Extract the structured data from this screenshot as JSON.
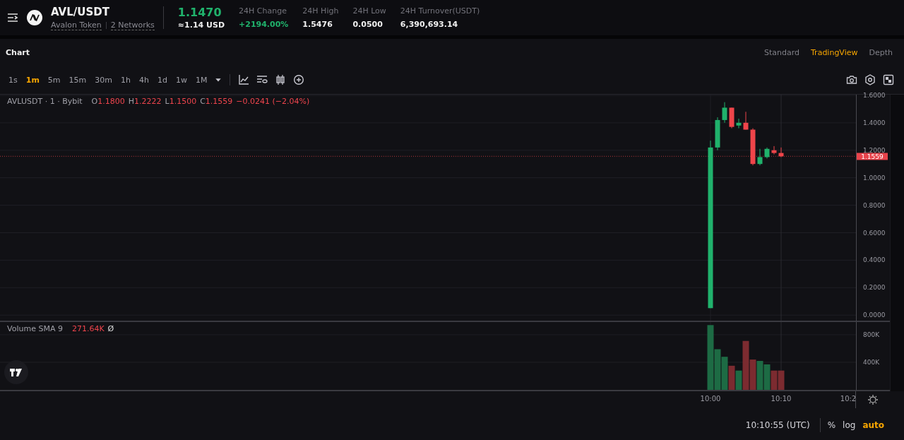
{
  "header": {
    "pair": "AVL/USDT",
    "token_name": "Avalon Token",
    "networks": "2 Networks",
    "price": "1.1470",
    "price_usd": "≈1.14 USD",
    "stats": [
      {
        "label": "24H Change",
        "value": "+2194.00%",
        "kind": "up"
      },
      {
        "label": "24H High",
        "value": "1.5476",
        "kind": "plain"
      },
      {
        "label": "24H Low",
        "value": "0.0500",
        "kind": "plain"
      },
      {
        "label": "24H Turnover(USDT)",
        "value": "6,390,693.14",
        "kind": "plain"
      }
    ]
  },
  "panel_title": "Chart",
  "view_tabs": [
    {
      "label": "Standard",
      "selected": false
    },
    {
      "label": "TradingView",
      "selected": true
    },
    {
      "label": "Depth",
      "selected": false
    }
  ],
  "intervals": [
    {
      "label": "1s",
      "selected": false
    },
    {
      "label": "1m",
      "selected": true
    },
    {
      "label": "5m",
      "selected": false
    },
    {
      "label": "15m",
      "selected": false
    },
    {
      "label": "30m",
      "selected": false
    },
    {
      "label": "1h",
      "selected": false
    },
    {
      "label": "4h",
      "selected": false
    },
    {
      "label": "1d",
      "selected": false
    },
    {
      "label": "1w",
      "selected": false
    },
    {
      "label": "1M",
      "selected": false
    }
  ],
  "legend": {
    "symbol": "AVLUSDT · 1 · Bybit",
    "ohlc": [
      {
        "label": "O",
        "value": "1.1800"
      },
      {
        "label": "H",
        "value": "1.2222"
      },
      {
        "label": "L",
        "value": "1.1500"
      },
      {
        "label": "C",
        "value": "1.1559"
      }
    ],
    "change": "−0.0241 (−2.04%)"
  },
  "price_axis": [
    "1.6000",
    "1.4000",
    "1.2000",
    "1.0000",
    "0.8000",
    "0.6000",
    "0.4000",
    "0.2000",
    "0.0000"
  ],
  "last_price": "1.1559",
  "volume": {
    "title": "Volume SMA 9",
    "value": "271.64K",
    "extra": "Ø",
    "axis": [
      "800K",
      "400K"
    ]
  },
  "time_axis": [
    "10:00",
    "10:10",
    "10:2"
  ],
  "footer": {
    "time": "10:10:55 (UTC)",
    "options": [
      {
        "label": "%",
        "selected": false
      },
      {
        "label": "log",
        "selected": false
      },
      {
        "label": "auto",
        "selected": true
      }
    ]
  }
}
